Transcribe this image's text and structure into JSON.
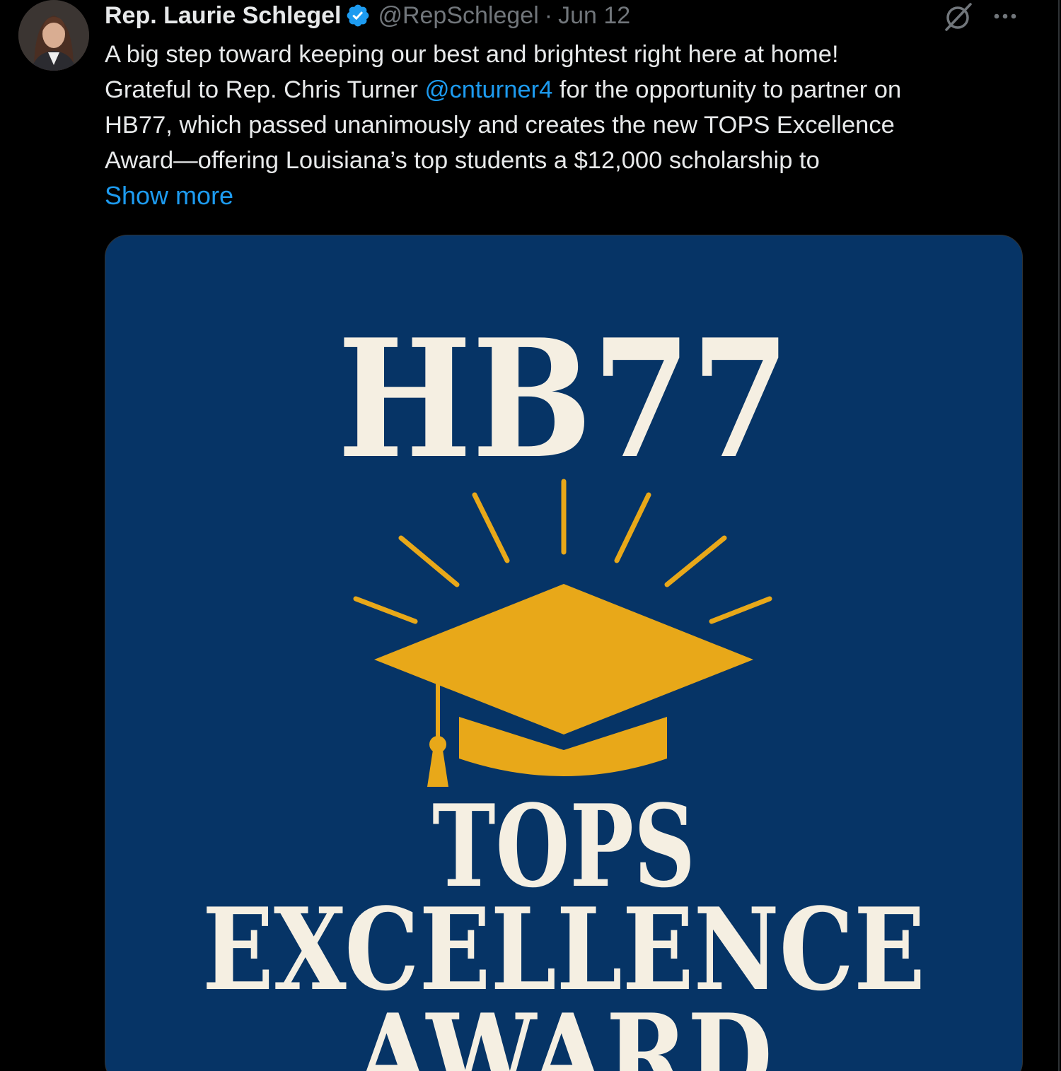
{
  "tweet": {
    "display_name": "Rep. Laurie Schlegel",
    "handle": "@RepSchlegel",
    "separator": "·",
    "date": "Jun 12",
    "verified": true,
    "text_line1": "A big step toward keeping our best and brightest right here at home!",
    "text_line2_pre": "Grateful to Rep. Chris Turner ",
    "mention": "@cnturner4",
    "text_line2_post": " for the opportunity to partner on",
    "text_line3": "HB77, which passed unanimously and creates the new TOPS Excellence",
    "text_line4": "Award—offering Louisiana’s top students a $12,000 scholarship to",
    "show_more": "Show more"
  },
  "media": {
    "headline": "HB77",
    "line1": "TOPS",
    "line2": "EXCELLENCE",
    "line3": "AWARD",
    "background_color": "#063466",
    "accent_color": "#e8a819",
    "text_color": "#f5efe2"
  },
  "icons": {
    "verified": "verified-badge-icon",
    "grok": "grok-icon",
    "more": "more-options-icon",
    "cap": "graduation-cap-icon"
  },
  "colors": {
    "background": "#000000",
    "link": "#1d9bf0",
    "secondary_text": "#71767b",
    "primary_text": "#e7e9ea"
  }
}
